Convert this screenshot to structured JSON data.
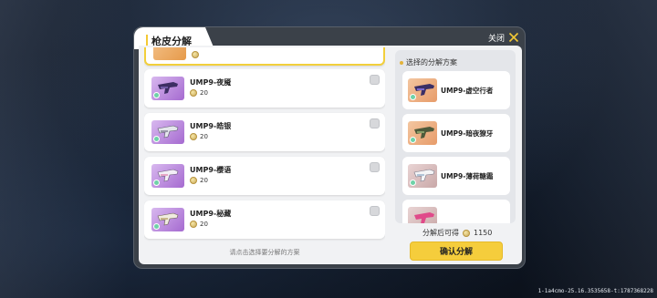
{
  "dialog": {
    "title": "枪皮分解",
    "close_label": "关闭"
  },
  "left_list": {
    "items": [
      {
        "name": "UMP9-夜魇",
        "cost": "20",
        "thumb": "purple"
      },
      {
        "name": "UMP9-皓银",
        "cost": "20",
        "thumb": "purple"
      },
      {
        "name": "UMP9-樱语",
        "cost": "20",
        "thumb": "purple"
      },
      {
        "name": "UMP9-秘藏",
        "cost": "20",
        "thumb": "purple"
      }
    ],
    "hint": "请点击选择要分解的方案"
  },
  "right_panel": {
    "header": "选择的分解方案",
    "items": [
      {
        "name": "UMP9-虚空行者",
        "thumb": "orange"
      },
      {
        "name": "UMP9-暗夜獠牙",
        "thumb": "orange"
      },
      {
        "name": "UMP9-薄荷糖霜",
        "thumb": "grey"
      }
    ]
  },
  "result": {
    "label": "分解后可得",
    "amount": "1150"
  },
  "confirm_label": "确认分解",
  "debug_text": "1-1a4cmo-25.16.3535658-t:1787368228",
  "colors": {
    "accent_yellow": "#f5cd3c",
    "dialog_bg": "#3b4149",
    "panel_bg": "#f1f2f4"
  }
}
